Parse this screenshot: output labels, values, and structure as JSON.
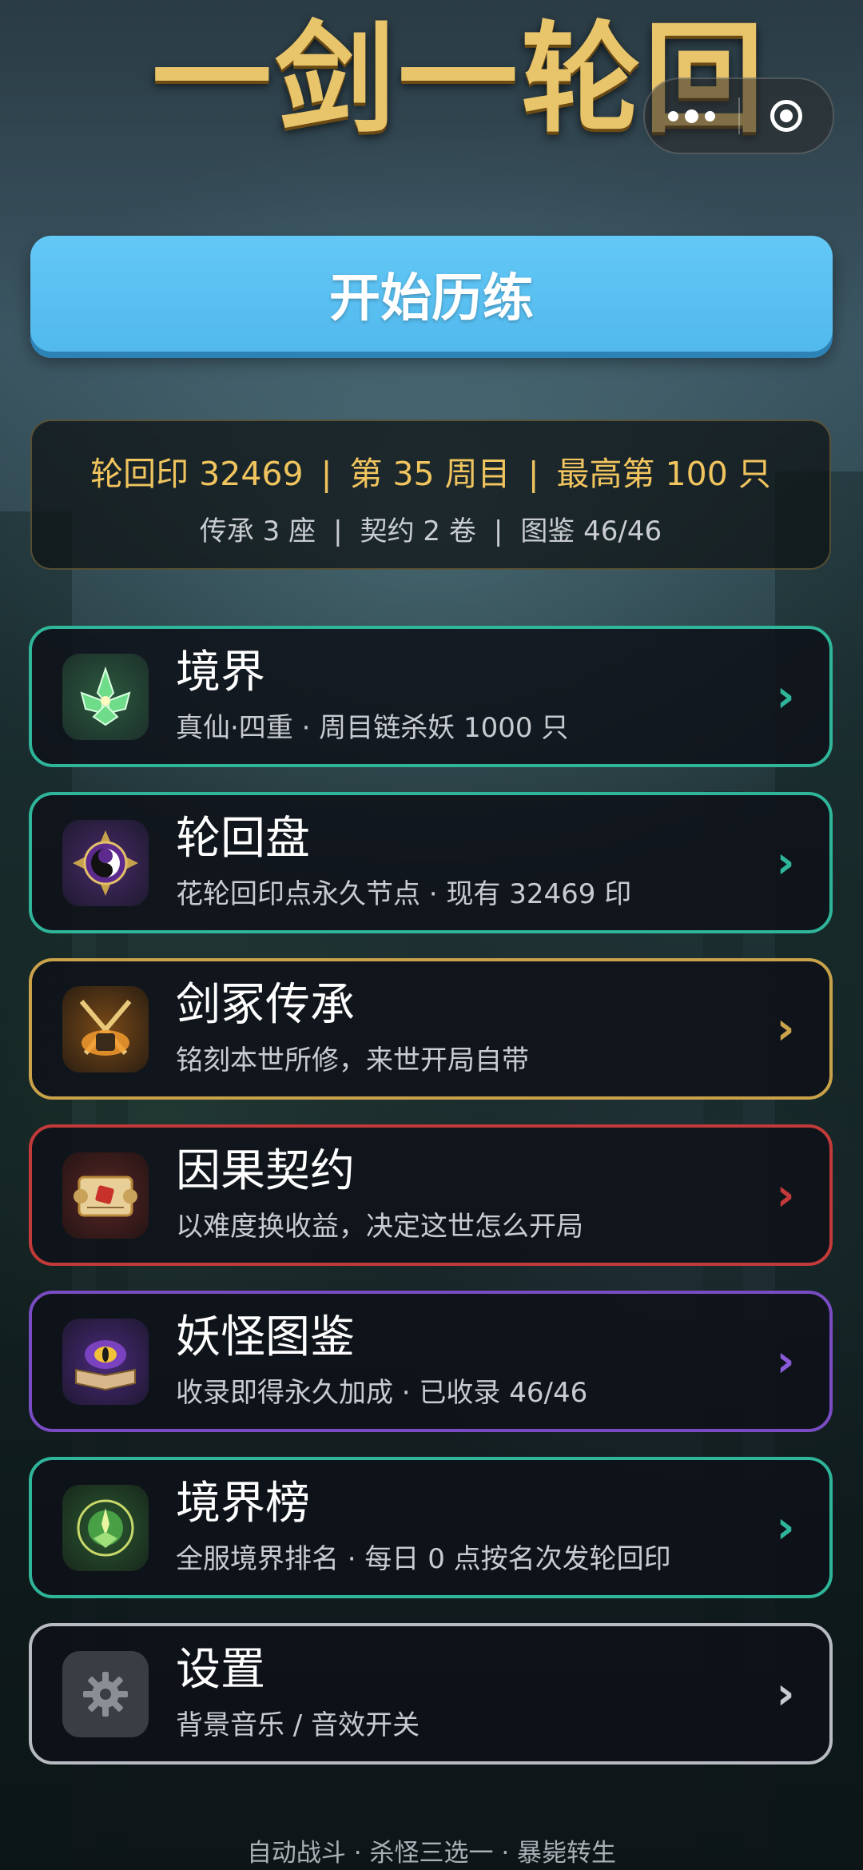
{
  "title": "一剑一轮回",
  "start_button": "开始历练",
  "stats": {
    "line1": [
      "轮回印 32469",
      "第 35 周目",
      "最高第 100 只"
    ],
    "line2": [
      "传承 3 座",
      "契约 2 卷",
      "图鉴 46/46"
    ],
    "separator": "|"
  },
  "menu": [
    {
      "name": "境界",
      "desc": "真仙·四重 · 周目链杀妖 1000 只",
      "icon": "jade-lotus-icon",
      "color": "#2fb59a"
    },
    {
      "name": "轮回盘",
      "desc": "花轮回印点永久节点 · 现有 32469 印",
      "icon": "yin-yang-wheel-icon",
      "color": "#2fb59a"
    },
    {
      "name": "剑冢传承",
      "desc": "铭刻本世所修，来世开局自带",
      "icon": "sword-tomb-icon",
      "color": "#c9a24a"
    },
    {
      "name": "因果契约",
      "desc": "以难度换收益，决定这世怎么开局",
      "icon": "contract-scroll-icon",
      "color": "#c23a3a"
    },
    {
      "name": "妖怪图鉴",
      "desc": "收录即得永久加成 · 已收录 46/46",
      "icon": "demon-book-icon",
      "color": "#7a4cc4"
    },
    {
      "name": "境界榜",
      "desc": "全服境界排名 · 每日 0 点按名次发轮回印",
      "icon": "jade-ranking-icon",
      "color": "#2fb59a"
    },
    {
      "name": "设置",
      "desc": "背景音乐 / 音效开关",
      "icon": "gear-icon",
      "color": "#b8bcc2"
    }
  ],
  "chevron": "›",
  "footer": "自动战斗 · 杀怪三选一 · 暴毙转生"
}
